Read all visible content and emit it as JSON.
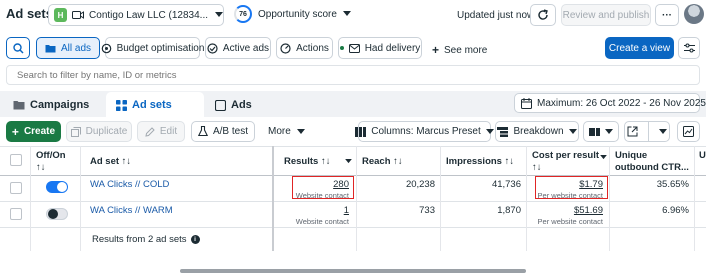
{
  "header": {
    "title": "Ad sets",
    "account_initial": "H",
    "account_name": "Contigo Law LLC (12834...",
    "opportunity_value": "76",
    "opportunity_label": "Opportunity score",
    "updated": "Updated just now",
    "review_publish": "Review and publish",
    "more": "···"
  },
  "filters": {
    "all_ads": "All ads",
    "budget": "Budget optimisation",
    "active_ads": "Active ads",
    "actions": "Actions",
    "had_delivery": "Had delivery",
    "see_more": "See more",
    "create_view": "Create a view"
  },
  "search": {
    "placeholder": "Search to filter by name, ID or metrics"
  },
  "tabs": {
    "campaigns": "Campaigns",
    "ad_sets": "Ad sets",
    "ads": "Ads"
  },
  "date_range": "Maximum: 26 Oct 2022 - 26 Nov 2025",
  "toolbar": {
    "create": "Create",
    "duplicate": "Duplicate",
    "edit": "Edit",
    "ab_test": "A/B test",
    "more": "More",
    "columns": "Columns: Marcus Preset",
    "breakdown": "Breakdown"
  },
  "table": {
    "headers": {
      "off_on": "Off/On",
      "off_on_sort": "↑↓",
      "ad_set": "Ad set ↑↓",
      "results": "Results ↑↓",
      "reach": "Reach ↑↓",
      "impressions": "Impressions ↑↓",
      "cost_per_result": "Cost per result",
      "cost_sort": "↑↓",
      "unique_ctr": "Unique",
      "unique_ctr_2": "outbound CTR..."
    },
    "rows": [
      {
        "name": "WA Clicks // COLD",
        "on": true,
        "results": "280",
        "results_sub": "Website contact",
        "reach": "20,238",
        "impressions": "41,736",
        "cost": "$1.79",
        "cost_sub": "Per website contact",
        "ctr": "35.65%"
      },
      {
        "name": "WA Clicks // WARM",
        "on": false,
        "results": "1",
        "results_sub": "Website contact",
        "reach": "733",
        "impressions": "1,870",
        "cost": "$51.69",
        "cost_sub": "Per website contact",
        "ctr": "6.96%"
      }
    ],
    "footer": "Results from 2 ad sets"
  },
  "colors": {
    "primary": "#0a66c2",
    "create_green": "#1a7a44",
    "highlight": "#e02525",
    "toggle_on": "#1877f2"
  }
}
